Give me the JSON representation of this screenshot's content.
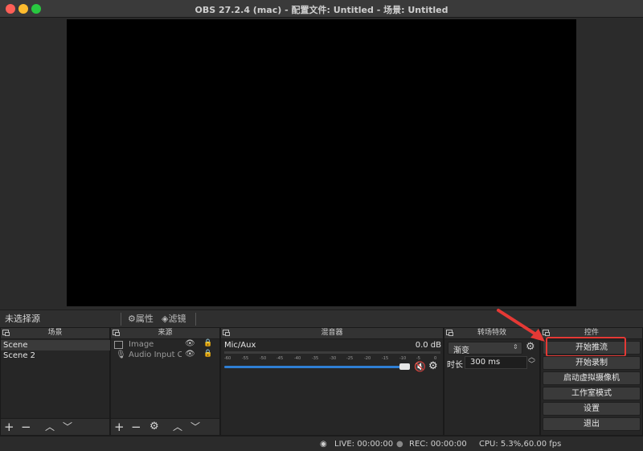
{
  "window": {
    "title": "OBS 27.2.4 (mac) - 配置文件: Untitled - 场景: Untitled"
  },
  "source_toolbar": {
    "selection": "未选择源",
    "properties_label": "属性",
    "filters_label": "滤镜"
  },
  "scenes": {
    "title": "场景",
    "items": [
      "Scene",
      "Scene 2"
    ]
  },
  "sources": {
    "title": "来源",
    "items": [
      {
        "label": "Image",
        "icon": "image-icon"
      },
      {
        "label": "Audio Input Ca",
        "icon": "mic-icon"
      }
    ]
  },
  "mixer": {
    "title": "混音器",
    "channel": "Mic/Aux",
    "level": "0.0 dB",
    "ticks": [
      "-60",
      "-55",
      "-50",
      "-45",
      "-40",
      "-35",
      "-30",
      "-25",
      "-20",
      "-15",
      "-10",
      "-5",
      "0"
    ],
    "volume": 1.0
  },
  "transitions": {
    "title": "转场特效",
    "type": "渐变",
    "duration_label": "时长",
    "duration": "300 ms"
  },
  "controls": {
    "title": "控件",
    "buttons": [
      "开始推流",
      "开始录制",
      "启动虚拟摄像机",
      "工作室模式",
      "设置",
      "退出"
    ]
  },
  "status": {
    "live": "LIVE: 00:00:00",
    "rec": "REC: 00:00:00",
    "cpu": "CPU: 5.3%,60.00 fps"
  },
  "colors": {
    "highlight": "#e53935",
    "mute": "#e53935",
    "slider": "#2f7fd4"
  }
}
